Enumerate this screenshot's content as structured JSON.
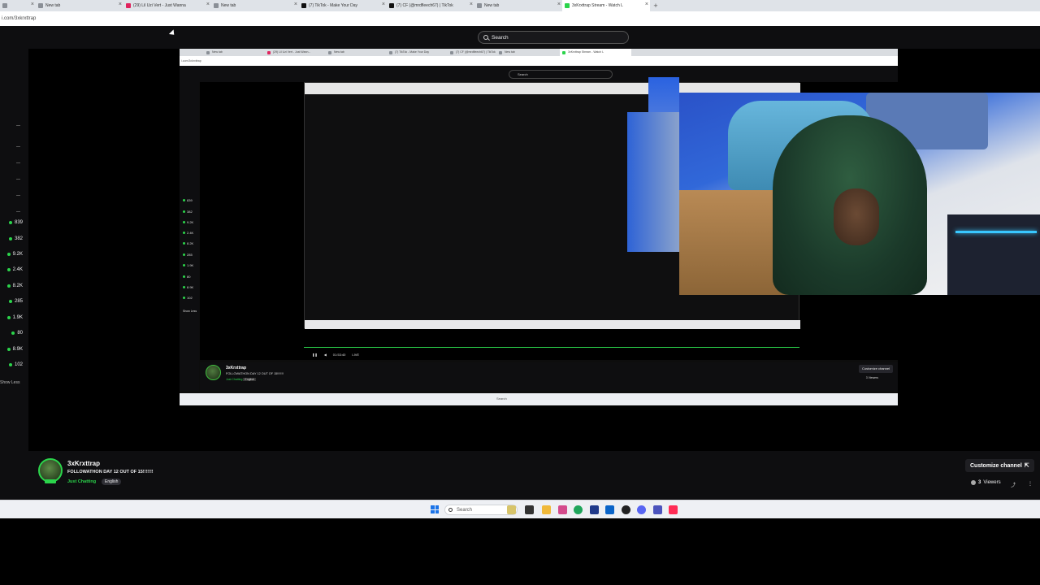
{
  "browser": {
    "tabs": [
      {
        "label": "",
        "active": false
      },
      {
        "label": "New tab",
        "active": false
      },
      {
        "label": "(29) Lil Uzi Vert - Just Wanna",
        "active": false
      },
      {
        "label": "New tab",
        "active": false
      },
      {
        "label": "(7) TikTok - Make Your Day",
        "active": false
      },
      {
        "label": "(7) CF (@mrdfleech67) | TikTok",
        "active": false
      },
      {
        "label": "New tab",
        "active": false
      },
      {
        "label": "3xKrxttrap Stream - Watch L",
        "active": true
      }
    ],
    "url": "i.com/3xkrxttrap"
  },
  "twitch": {
    "search_placeholder": "Search",
    "sidebar": {
      "viewer_counts": [
        "839",
        "382",
        "9.2K",
        "2.4K",
        "8.2K",
        "285",
        "1.9K",
        "80",
        "8.9K",
        "102"
      ],
      "show_less": "Show Less"
    },
    "capture": {
      "tabs": [
        "New tab",
        "(29) Lil Uzi Vert - Just Wann...",
        "New tab",
        "(7) TikTok - Make Your Day",
        "(7) CF (@mrdfleech67) | TikTok",
        "New tab",
        "3xKrxttrap Stream - Watch L"
      ],
      "url": "i.com/3xkrxttrap",
      "search": "Search",
      "side_counts": [
        "839",
        "382",
        "9.2K",
        "2.4K",
        "8.2K",
        "285",
        "1.9K",
        "80",
        "8.9K",
        "102"
      ],
      "show_less": "Show Less",
      "time": "01:53:40",
      "live": "LIVE",
      "channel": "3xKrxttrap",
      "title": "FOLLOWATHON DAY 12 OUT OF 15!!!!!!!",
      "category": "Just Chatting",
      "language": "English",
      "customize": "Customize channel",
      "viewers": "3 Viewers",
      "taskbar_search": "Search"
    },
    "channel": {
      "name": "3xKrxttrap",
      "title": "FOLLOWATHON DAY 12 OUT OF 15!!!!!!!",
      "category": "Just Chatting",
      "language": "English",
      "live_badge": "LIVE",
      "customize_label": "Customize channel",
      "viewer_count": "3",
      "viewer_label": "Viewers"
    }
  },
  "taskbar": {
    "search_placeholder": "Search",
    "apps": [
      "chrome",
      "file-explorer",
      "folder",
      "store",
      "edge",
      "calculator",
      "outlook",
      "roblox",
      "discord",
      "teams",
      "tiktok"
    ]
  },
  "colors": {
    "accent_green": "#2bd44b",
    "twitch_bg": "#0e0e10"
  }
}
